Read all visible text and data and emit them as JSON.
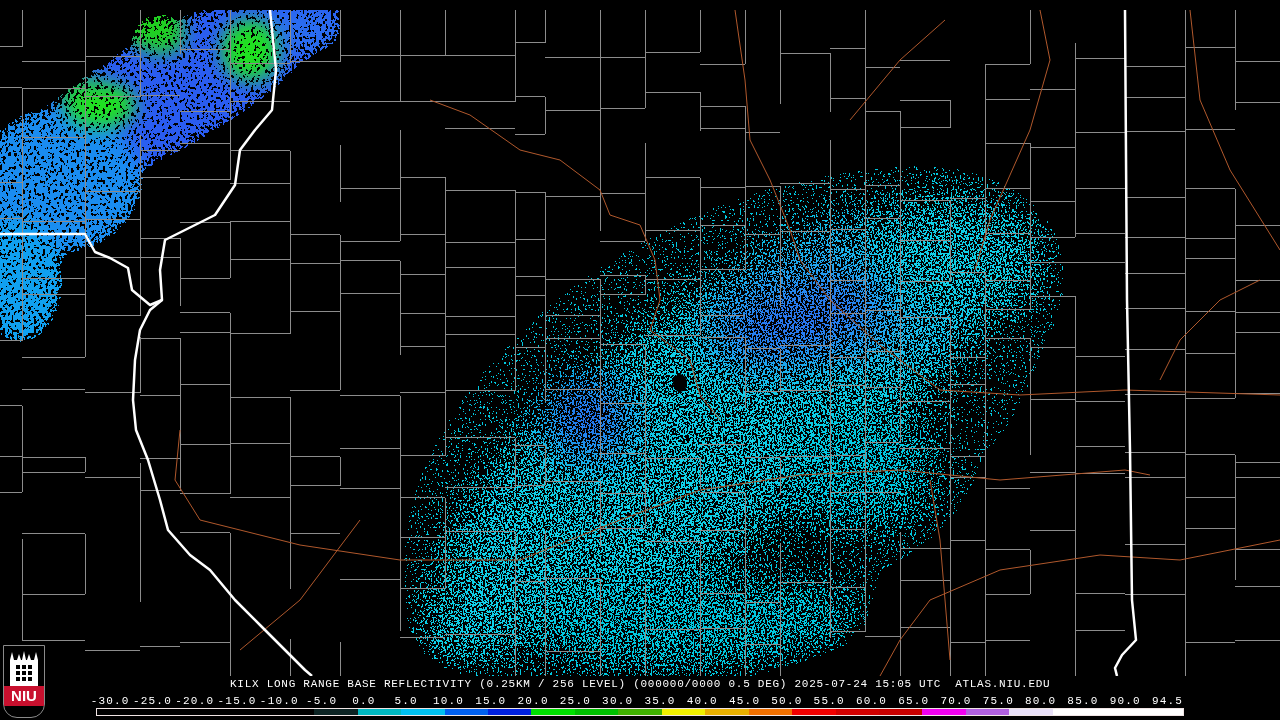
{
  "map": {
    "caption": {
      "title": "KILX LONG RANGE BASE REFLECTIVITY (0.25KM / 256 LEVEL) (000000/0000 0.5 DEG) 2025-07-24 15:05 UTC",
      "site": "ATLAS.NIU.EDU"
    }
  },
  "logo": {
    "text": "NIU"
  },
  "color_scale": {
    "labels": [
      "-30.0",
      "-25.0",
      "-20.0",
      "-15.0",
      "-10.0",
      "-5.0",
      "0.0",
      "5.0",
      "10.0",
      "15.0",
      "20.0",
      "25.0",
      "30.0",
      "35.0",
      "40.0",
      "45.0",
      "50.0",
      "55.0",
      "60.0",
      "65.0",
      "70.0",
      "75.0",
      "80.0",
      "85.0",
      "90.0",
      "94.5"
    ],
    "segments": [
      {
        "color": "#0c2424"
      },
      {
        "color": "#00b8c0"
      },
      {
        "color": "#00c0f0"
      },
      {
        "color": "#0060f0"
      },
      {
        "color": "#0020e0"
      },
      {
        "color": "#00e000"
      },
      {
        "color": "#00c000"
      },
      {
        "color": "#40b000"
      },
      {
        "color": "#f0f000"
      },
      {
        "color": "#e8b000"
      },
      {
        "color": "#f07000"
      },
      {
        "color": "#f00000"
      },
      {
        "color": "#d00000"
      },
      {
        "color": "#c80000"
      },
      {
        "color": "#f000f0"
      },
      {
        "color": "#b060e0"
      },
      {
        "color": "#e8e0f8"
      },
      {
        "color": "#ffffff"
      },
      {
        "color": "#ffffff"
      },
      {
        "color": "#ffffff"
      }
    ]
  }
}
